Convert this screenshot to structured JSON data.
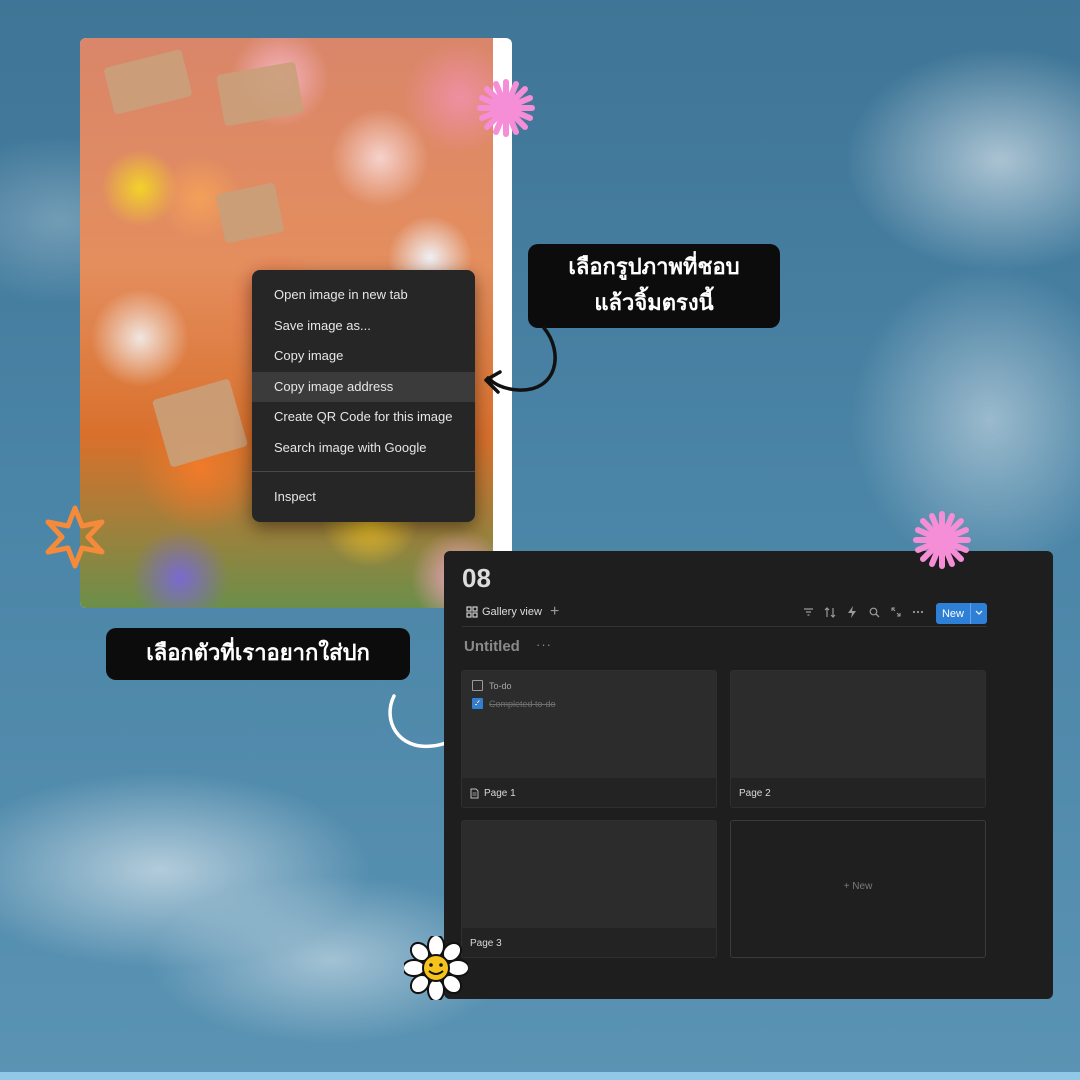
{
  "context_menu": {
    "items": [
      "Open image in new tab",
      "Save image as...",
      "Copy image",
      "Copy image address",
      "Create QR Code for this image",
      "Search image with Google"
    ],
    "inspect": "Inspect"
  },
  "callouts": {
    "select_image_line1": "เลือกรูปภาพที่ชอบ",
    "select_image_line2": "แล้วจิ้มตรงนี้",
    "select_cover": "เลือกตัวที่เราอยากใส่ปก"
  },
  "notion": {
    "page_title": "08",
    "view_tab_label": "Gallery view",
    "add_view_symbol": "+",
    "new_button_label": "New",
    "database_title": "Untitled",
    "more_symbol": "···",
    "cards": [
      {
        "label": "Page 1",
        "todos": [
          {
            "text": "To-do",
            "checked": false
          },
          {
            "text": "Completed to-do",
            "checked": true
          }
        ]
      },
      {
        "label": "Page 2"
      },
      {
        "label": "Page 3"
      }
    ],
    "new_card_label": "+ New"
  },
  "colors": {
    "accent_blue": "#2e7fd6",
    "callout_bg": "#0c0c0c",
    "menu_bg": "#262626",
    "sky": "#4a84a6"
  }
}
